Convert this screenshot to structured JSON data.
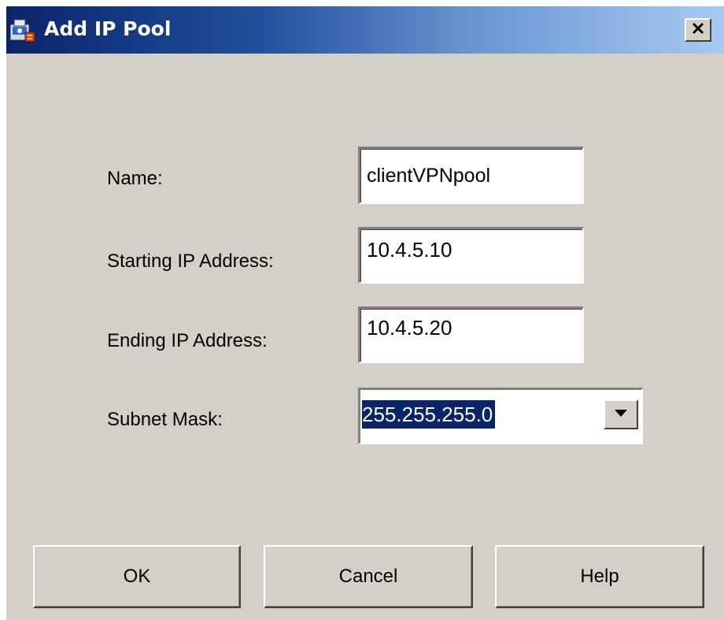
{
  "window": {
    "title": "Add IP Pool",
    "icon": "asdm-app-icon",
    "close_icon": "close-x-icon"
  },
  "form": {
    "name": {
      "label": "Name:",
      "value": "clientVPNpool"
    },
    "start_ip": {
      "label": "Starting IP Address:",
      "value": "10.4.5.10"
    },
    "end_ip": {
      "label": "Ending IP Address:",
      "value": "10.4.5.20"
    },
    "subnet_mask": {
      "label": "Subnet Mask:",
      "value": "255.255.255.0",
      "dropdown_icon": "chevron-down-icon"
    }
  },
  "buttons": {
    "ok": "OK",
    "cancel": "Cancel",
    "help": "Help"
  },
  "colors": {
    "dialog_bg": "#d4d0c8",
    "title_gradient_start": "#0a246a",
    "title_gradient_end": "#a6caf0",
    "selection_bg": "#0a246a"
  }
}
